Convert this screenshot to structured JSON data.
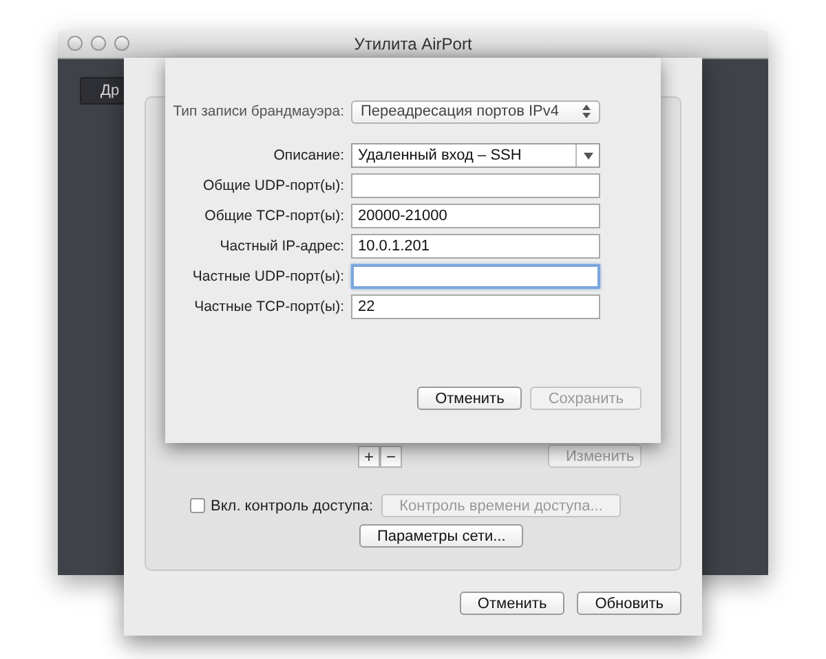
{
  "window": {
    "title": "Утилита AirPort"
  },
  "background_button": {
    "label": "Др"
  },
  "settings": {
    "add_label": "+",
    "remove_label": "−",
    "edit_button": {
      "label": "Изменить",
      "disabled": true
    },
    "access_control": {
      "label": "Вкл. контроль доступа:",
      "checked": false
    },
    "access_time_button": {
      "label": "Контроль времени доступа...",
      "disabled": true
    },
    "network_button": {
      "label": "Параметры сети...",
      "disabled": false
    },
    "buttons": [
      {
        "label": "Отменить",
        "disabled": false
      },
      {
        "label": "Обновить",
        "disabled": false
      }
    ]
  },
  "firewall_sheet": {
    "entry_type": {
      "label": "Тип записи брандмауэра:",
      "value": "Переадресация портов IPv4"
    },
    "description": {
      "label": "Описание:",
      "value": "Удаленный вход – SSH"
    },
    "fields": [
      {
        "label": "Общие UDP-порт(ы):",
        "focused": false
      },
      {
        "label": "Общие TCP-порт(ы):",
        "value": "20000-21000",
        "focused": false
      },
      {
        "label": "Частный IP-адрес:",
        "value": "10.0.1.201",
        "focused": false
      },
      {
        "label": "Частные UDP-порт(ы):",
        "focused": true
      },
      {
        "label": "Частные TCP-порт(ы):",
        "value": "22",
        "focused": false
      }
    ],
    "buttons": [
      {
        "label": "Отменить",
        "disabled": false
      },
      {
        "label": "Сохранить",
        "disabled": true
      }
    ]
  }
}
